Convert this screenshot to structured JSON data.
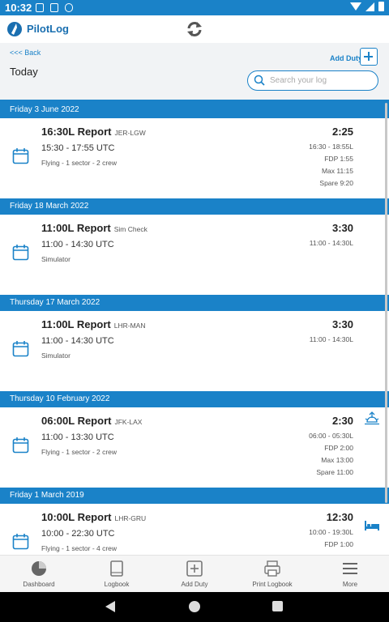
{
  "status": {
    "time": "10:32"
  },
  "app": {
    "name": "PilotLog"
  },
  "header": {
    "back": "<<< Back",
    "title": "Today",
    "add_duty": "Add Duty",
    "search_placeholder": "Search your log"
  },
  "colors": {
    "accent": "#1a82c8",
    "section_bg": "#1a82c8",
    "subheader_bg": "#f1f3f5"
  },
  "sections": [
    {
      "date": "Friday 3 June 2022",
      "duty": {
        "report": "16:30L Report",
        "route": "JER-LGW",
        "utc": "15:30 - 17:55 UTC",
        "desc": "Flying - 1 sector - 2 crew",
        "duration": "2:25",
        "lines": [
          "16:30 - 18:55L",
          "FDP 1:55",
          "Max 11:15",
          "Spare 9:20"
        ],
        "icon": "none"
      }
    },
    {
      "date": "Friday 18 March 2022",
      "duty": {
        "report": "11:00L Report",
        "route": "Sim Check",
        "utc": "11:00 - 14:30 UTC",
        "desc": "Simulator",
        "duration": "3:30",
        "lines": [
          "11:00 - 14:30L"
        ],
        "icon": "none"
      }
    },
    {
      "date": "Thursday 17 March 2022",
      "duty": {
        "report": "11:00L Report",
        "route": "LHR-MAN",
        "utc": "11:00 - 14:30 UTC",
        "desc": "Simulator",
        "duration": "3:30",
        "lines": [
          "11:00 - 14:30L"
        ],
        "icon": "none"
      }
    },
    {
      "date": "Thursday 10 February 2022",
      "duty": {
        "report": "06:00L Report",
        "route": "JFK-LAX",
        "utc": "11:00 - 13:30 UTC",
        "desc": "Flying - 1 sector - 2 crew",
        "duration": "2:30",
        "lines": [
          "06:00 - 05:30L",
          "FDP 2:00",
          "Max 13:00",
          "Spare 11:00"
        ],
        "icon": "sunrise-icon"
      }
    },
    {
      "date": "Friday 1 March 2019",
      "duty": {
        "report": "10:00L Report",
        "route": "LHR-GRU",
        "utc": "10:00 - 22:30 UTC",
        "desc": "Flying - 1 sector - 4 crew",
        "duration": "12:30",
        "lines": [
          "10:00 - 19:30L",
          "FDP 1:00"
        ],
        "icon": "bed-icon"
      }
    }
  ],
  "bottom_nav": [
    {
      "label": "Dashboard",
      "icon": "pie-chart-icon"
    },
    {
      "label": "Logbook",
      "icon": "book-icon"
    },
    {
      "label": "Add Duty",
      "icon": "plus-box-icon"
    },
    {
      "label": "Print Logbook",
      "icon": "printer-icon"
    },
    {
      "label": "More",
      "icon": "menu-icon"
    }
  ]
}
